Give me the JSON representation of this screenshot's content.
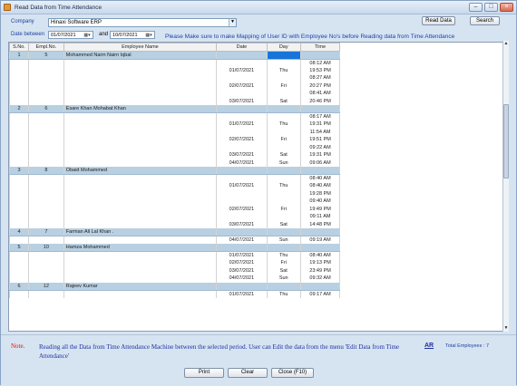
{
  "window": {
    "title": "Read Data from Time Attendance"
  },
  "company": {
    "label": "Company",
    "value": "Hinaxi Software ERP"
  },
  "dates": {
    "label": "Date between",
    "from": "01/07/2021",
    "and_label": "and",
    "to": "10/07/2021"
  },
  "buttons": {
    "read_data": "Read Data",
    "search": "Search",
    "print": "Print",
    "clear": "Clear",
    "close": "Close (F10)"
  },
  "info_message": "Please Make sure to make Mapping of User ID with Employee No's before Reading data from Time Attendance",
  "table": {
    "headers": [
      "S.No.",
      "Empl.No.",
      "Employee Name",
      "Date",
      "Day",
      "Time"
    ],
    "rows": [
      {
        "type": "group",
        "sno": "1",
        "empno": "5",
        "name": "Mohammed Nairn Nairn Iqbal",
        "sel": true
      },
      {
        "type": "time",
        "date": "",
        "day": "",
        "time": "08:12 AM"
      },
      {
        "type": "time",
        "date": "01/07/2021",
        "day": "Thu",
        "time": "19:53 PM"
      },
      {
        "type": "time",
        "date": "",
        "day": "",
        "time": "08:27 AM"
      },
      {
        "type": "time",
        "date": "02/07/2021",
        "day": "Fri",
        "time": "20:27 PM"
      },
      {
        "type": "time",
        "date": "",
        "day": "",
        "time": "08:41 AM"
      },
      {
        "type": "time",
        "date": "03/07/2021",
        "day": "Sat",
        "time": "20:46 PM"
      },
      {
        "type": "group",
        "sno": "2",
        "empno": "6",
        "name": "Esare Khan Mohabat Khan"
      },
      {
        "type": "time",
        "date": "",
        "day": "",
        "time": "08:17 AM"
      },
      {
        "type": "time",
        "date": "01/07/2021",
        "day": "Thu",
        "time": "19:31 PM"
      },
      {
        "type": "time",
        "date": "",
        "day": "",
        "time": "11:54 AM"
      },
      {
        "type": "time",
        "date": "02/07/2021",
        "day": "Fri",
        "time": "19:51 PM"
      },
      {
        "type": "time",
        "date": "",
        "day": "",
        "time": "09:22 AM"
      },
      {
        "type": "time",
        "date": "03/07/2021",
        "day": "Sat",
        "time": "19:31 PM"
      },
      {
        "type": "time",
        "date": "04/07/2021",
        "day": "Sun",
        "time": "09:06 AM"
      },
      {
        "type": "group",
        "sno": "3",
        "empno": "8",
        "name": "Obaid Mohammed"
      },
      {
        "type": "time",
        "date": "",
        "day": "",
        "time": "08:40 AM"
      },
      {
        "type": "time",
        "date": "01/07/2021",
        "day": "Thu",
        "time": "08:40 AM"
      },
      {
        "type": "time",
        "date": "",
        "day": "",
        "time": "19:28 PM"
      },
      {
        "type": "time",
        "date": "",
        "day": "",
        "time": "09:40 AM"
      },
      {
        "type": "time",
        "date": "02/07/2021",
        "day": "Fri",
        "time": "19:49 PM"
      },
      {
        "type": "time",
        "date": "",
        "day": "",
        "time": "09:11 AM"
      },
      {
        "type": "time",
        "date": "03/07/2021",
        "day": "Sat",
        "time": "14:48 PM"
      },
      {
        "type": "group",
        "sno": "4",
        "empno": "7",
        "name": "Farman Ali Lal Khan ."
      },
      {
        "type": "time",
        "date": "04/07/2021",
        "day": "Sun",
        "time": "09:19 AM"
      },
      {
        "type": "group",
        "sno": "5",
        "empno": "10",
        "name": "Hamza Mohammed"
      },
      {
        "type": "time",
        "date": "01/07/2021",
        "day": "Thu",
        "time": "08:40 AM"
      },
      {
        "type": "time",
        "date": "02/07/2021",
        "day": "Fri",
        "time": "19:13 PM"
      },
      {
        "type": "time",
        "date": "03/07/2021",
        "day": "Sat",
        "time": "23:49 PM"
      },
      {
        "type": "time",
        "date": "04/07/2021",
        "day": "Sun",
        "time": "09:32 AM"
      },
      {
        "type": "group",
        "sno": "6",
        "empno": "12",
        "name": "Rajeev Kumar"
      },
      {
        "type": "time",
        "date": "01/07/2021",
        "day": "Thu",
        "time": "09:17 AM"
      }
    ]
  },
  "footer": {
    "note_label": "Note.",
    "note_text": "Reading all the Data from Time Attendance Machine between the selected period. User can Edit the data from the menu 'Edit Data from Time Attendance'",
    "ar_link": "AR",
    "total_label": "Total Employees :",
    "total_value": "7"
  },
  "colors": {
    "group_row": "#b8d0e2",
    "selected_cell": "#1874d8",
    "label_blue": "#1f3fa0",
    "note_red": "#e01010"
  }
}
